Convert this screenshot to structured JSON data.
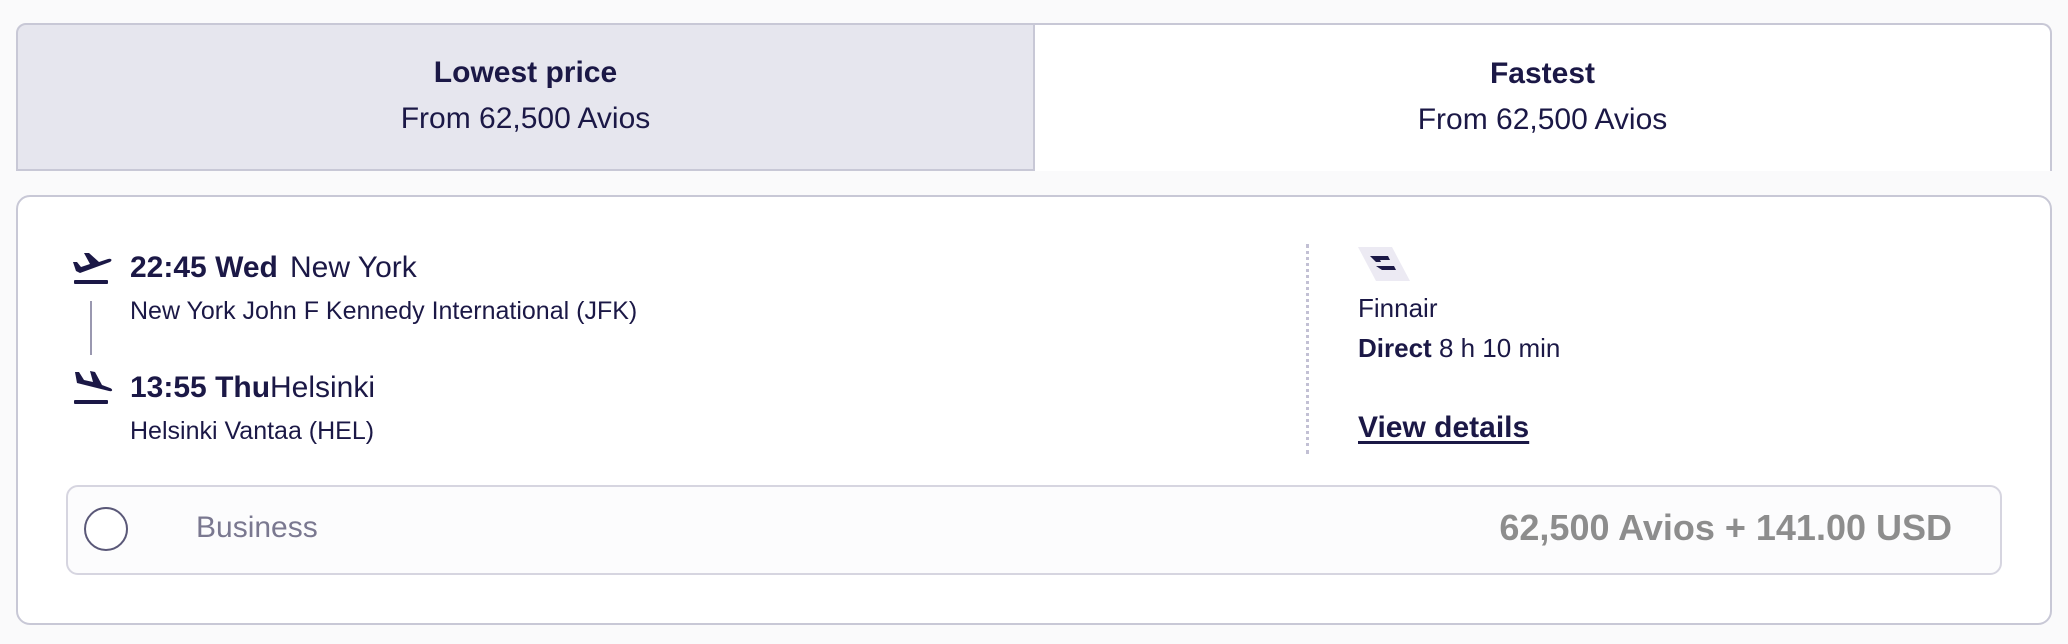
{
  "tabs": [
    {
      "title": "Lowest price",
      "subtitle": "From 62,500 Avios",
      "active": true
    },
    {
      "title": "Fastest",
      "subtitle": "From 62,500 Avios",
      "active": false
    }
  ],
  "flight": {
    "departure": {
      "time": "22:45 Wed",
      "city": "New York",
      "airport": "New York John F Kennedy International (JFK)",
      "icon": "takeoff-icon"
    },
    "arrival": {
      "time": "13:55 Thu",
      "city": "Helsinki",
      "airport": "Helsinki Vantaa (HEL)",
      "icon": "landing-icon"
    },
    "airline": {
      "name": "Finnair",
      "logo_icon": "finnair-logo-icon"
    },
    "stops": "Direct",
    "duration": "8 h 10 min",
    "view_details_label": "View details"
  },
  "fare": {
    "cabin": "Business",
    "price": "62,500 Avios + 141.00 USD",
    "selected": false
  },
  "colors": {
    "text_primary": "#1b1846",
    "active_tab_bg": "#e6e6ee",
    "price_text": "#8d8d8d",
    "border": "#c8c8d6"
  }
}
